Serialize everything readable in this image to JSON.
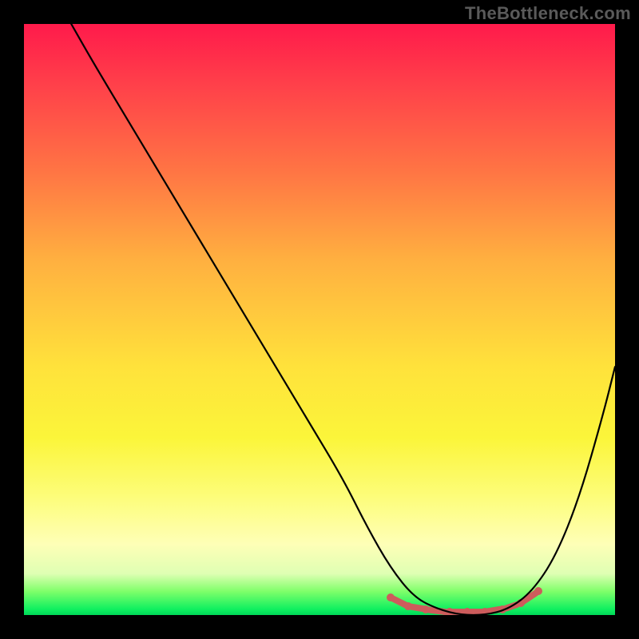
{
  "watermark": "TheBottleneck.com",
  "colors": {
    "marker": "#cd5c5c",
    "curve": "#000000"
  },
  "chart_data": {
    "type": "line",
    "title": "",
    "xlabel": "",
    "ylabel": "",
    "xlim": [
      0,
      100
    ],
    "ylim": [
      0,
      100
    ],
    "series": [
      {
        "name": "bottleneck-curve",
        "x": [
          8,
          12,
          18,
          24,
          30,
          36,
          42,
          48,
          54,
          58,
          62,
          66,
          70,
          74,
          78,
          82,
          86,
          90,
          94,
          98,
          100
        ],
        "y": [
          100,
          93,
          83,
          73,
          63,
          53,
          43,
          33,
          23,
          15,
          8,
          3,
          1,
          0,
          0,
          1,
          4,
          10,
          20,
          34,
          42
        ]
      }
    ],
    "markers": {
      "name": "highlight-points",
      "color": "#cd5c5c",
      "x": [
        62,
        65,
        68,
        72,
        75,
        78,
        81,
        84,
        87
      ],
      "y": [
        3,
        1.5,
        1,
        0.5,
        0.5,
        0.5,
        1,
        2,
        4
      ]
    },
    "gradient_stops": [
      {
        "pos": 0,
        "color": "#ff1a4b"
      },
      {
        "pos": 25,
        "color": "#ff7544"
      },
      {
        "pos": 58,
        "color": "#ffe23b"
      },
      {
        "pos": 88,
        "color": "#feffb7"
      },
      {
        "pos": 96,
        "color": "#7fff6a"
      },
      {
        "pos": 100,
        "color": "#00d858"
      }
    ]
  }
}
